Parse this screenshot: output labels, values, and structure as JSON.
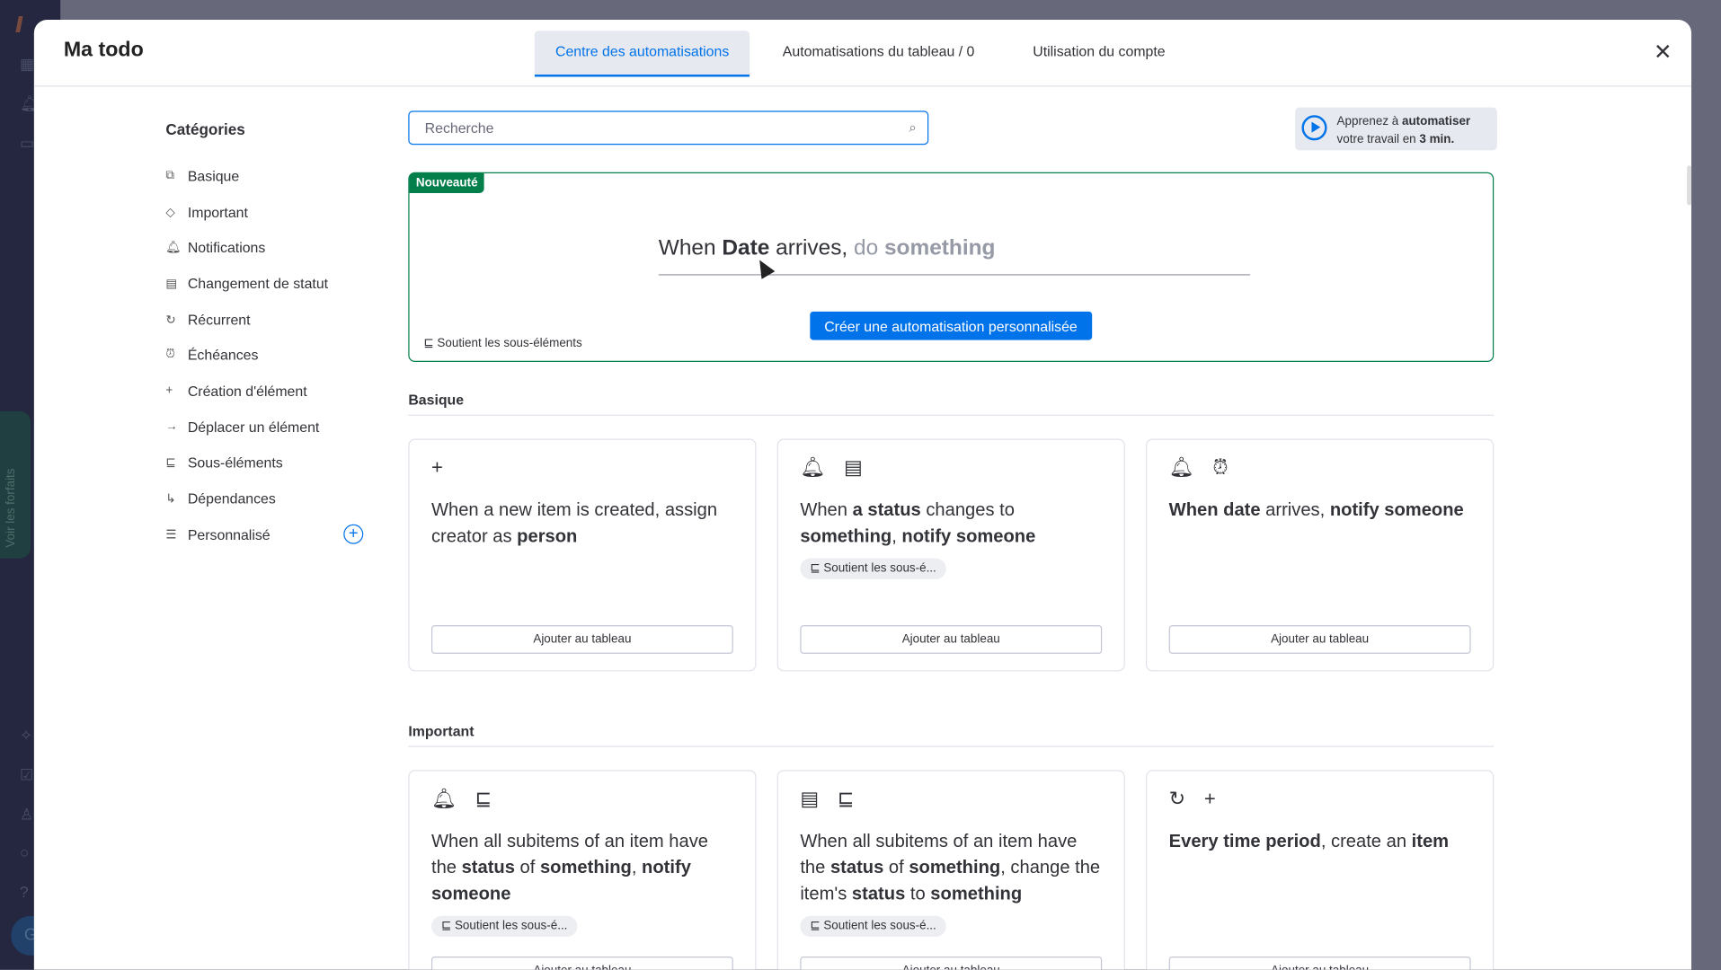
{
  "app": {
    "plans_label": "Voir les forfaits",
    "avatar_initial": "G"
  },
  "modal": {
    "title": "Ma todo",
    "tabs": [
      {
        "label": "Centre des automatisations",
        "active": true
      },
      {
        "label": "Automatisations du tableau  / 0",
        "active": false
      },
      {
        "label": "Utilisation du compte",
        "active": false
      }
    ]
  },
  "categories": {
    "title": "Catégories",
    "items": [
      {
        "label": "Basique",
        "icon": "sitemap-icon"
      },
      {
        "label": "Important",
        "icon": "diamond-icon"
      },
      {
        "label": "Notifications",
        "icon": "bell-icon"
      },
      {
        "label": "Changement de statut",
        "icon": "status-icon"
      },
      {
        "label": "Récurrent",
        "icon": "recurring-icon"
      },
      {
        "label": "Échéances",
        "icon": "alarm-icon"
      },
      {
        "label": "Création d'élément",
        "icon": "plus-icon"
      },
      {
        "label": "Déplacer un élément",
        "icon": "arrow-right-icon"
      },
      {
        "label": "Sous-éléments",
        "icon": "subitems-icon"
      },
      {
        "label": "Dépendances",
        "icon": "dependency-icon"
      },
      {
        "label": "Personnalisé",
        "icon": "sliders-icon"
      }
    ]
  },
  "search": {
    "placeholder": "Recherche",
    "value": ""
  },
  "learn": {
    "pre": "Apprenez à ",
    "bold": "automatiser",
    "pre2": "votre travail en ",
    "bold2": "3 min."
  },
  "hero": {
    "badge": "Nouveauté",
    "s1": "When ",
    "s2": "Date",
    "s3": " arrives, ",
    "s4": " do ",
    "s5": "something",
    "button": "Créer une automatisation personnalisée",
    "subitems": "Soutient les sous-éléments"
  },
  "sections": [
    {
      "title": "Basique",
      "cards": [
        {
          "icons": "+",
          "segments": [
            [
              "When a new item is created, assign creator as ",
              false
            ],
            [
              "person",
              true
            ]
          ],
          "chip": "",
          "button": "Ajouter au tableau"
        },
        {
          "icons": "🔔︎ ▤",
          "segments": [
            [
              "When ",
              false
            ],
            [
              "a status",
              true
            ],
            [
              " changes to ",
              false
            ],
            [
              "something",
              true
            ],
            [
              ", ",
              false
            ],
            [
              "notify someone",
              true
            ]
          ],
          "chip": "Soutient les sous-é...",
          "button": "Ajouter au tableau"
        },
        {
          "icons": "🔔︎ ⏰︎",
          "segments": [
            [
              "When date",
              true
            ],
            [
              " arrives, ",
              false
            ],
            [
              "notify someone",
              true
            ]
          ],
          "chip": "",
          "button": "Ajouter au tableau"
        }
      ]
    },
    {
      "title": "Important",
      "cards": [
        {
          "icons": "🔔︎ ⊑",
          "segments": [
            [
              "When all subitems of an item have the ",
              false
            ],
            [
              "status",
              true
            ],
            [
              " of ",
              false
            ],
            [
              "something",
              true
            ],
            [
              ", ",
              false
            ],
            [
              "notify someone",
              true
            ]
          ],
          "chip": "Soutient les sous-é...",
          "button": "Ajouter au tableau"
        },
        {
          "icons": "▤ ⊑",
          "segments": [
            [
              "When all subitems of an item have the ",
              false
            ],
            [
              "status",
              true
            ],
            [
              " of ",
              false
            ],
            [
              "something",
              true
            ],
            [
              ", change the item's ",
              false
            ],
            [
              "status",
              true
            ],
            [
              " to ",
              false
            ],
            [
              "something",
              true
            ]
          ],
          "chip": "Soutient les sous-é...",
          "button": "Ajouter au tableau"
        },
        {
          "icons": "↻ +",
          "segments": [
            [
              "Every time period",
              true
            ],
            [
              ", create an ",
              false
            ],
            [
              "item",
              true
            ]
          ],
          "chip": "",
          "button": "Ajouter au tableau"
        }
      ]
    }
  ]
}
